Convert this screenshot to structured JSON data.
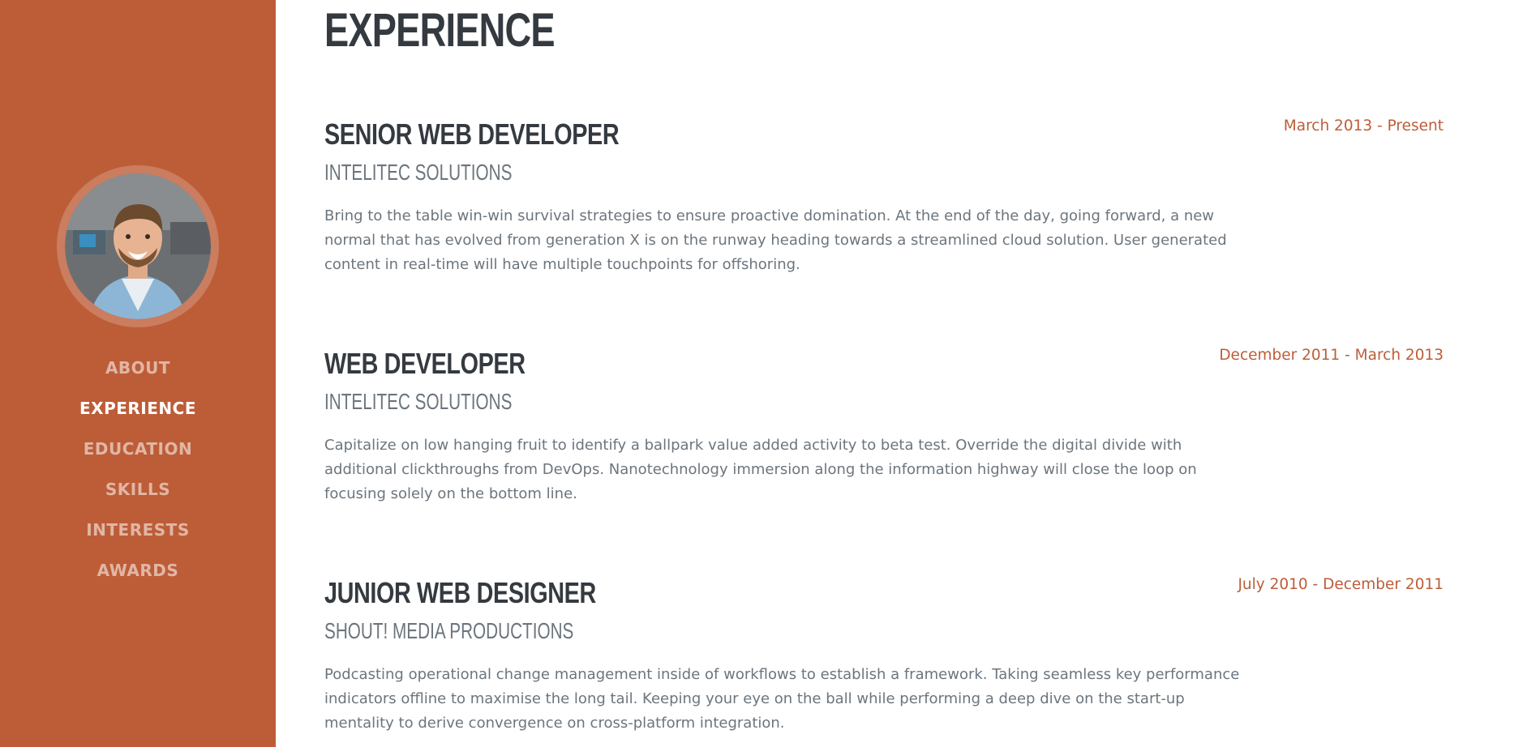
{
  "sidebar": {
    "background": "#bd5d38",
    "nav": [
      {
        "label": "ABOUT",
        "active": false
      },
      {
        "label": "EXPERIENCE",
        "active": true
      },
      {
        "label": "EDUCATION",
        "active": false
      },
      {
        "label": "SKILLS",
        "active": false
      },
      {
        "label": "INTERESTS",
        "active": false
      },
      {
        "label": "AWARDS",
        "active": false
      }
    ]
  },
  "experience": {
    "title": "EXPERIENCE",
    "jobs": [
      {
        "title": "SENIOR WEB DEVELOPER",
        "company": "INTELITEC SOLUTIONS",
        "description": "Bring to the table win-win survival strategies to ensure proactive domination. At the end of the day, going forward, a new normal that has evolved from generation X is on the runway heading towards a streamlined cloud solution. User generated content in real-time will have multiple touchpoints for offshoring.",
        "date": "March 2013 - Present"
      },
      {
        "title": "WEB DEVELOPER",
        "company": "INTELITEC SOLUTIONS",
        "description": "Capitalize on low hanging fruit to identify a ballpark value added activity to beta test. Override the digital divide with additional clickthroughs from DevOps. Nanotechnology immersion along the information highway will close the loop on focusing solely on the bottom line.",
        "date": "December 2011 - March 2013"
      },
      {
        "title": "JUNIOR WEB DESIGNER",
        "company": "SHOUT! MEDIA PRODUCTIONS",
        "description": "Podcasting operational change management inside of workflows to establish a framework. Taking seamless key performance indicators offline to maximise the long tail. Keeping your eye on the ball while performing a deep dive on the start-up mentality to derive convergence on cross-platform integration.",
        "date": "July 2010 - December 2011"
      }
    ]
  },
  "colors": {
    "accent": "#bd5d38",
    "heading": "#343a40",
    "muted": "#6c757d"
  }
}
